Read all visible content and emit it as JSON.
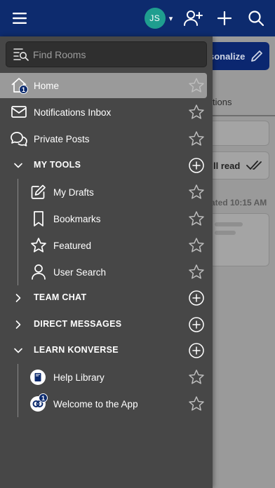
{
  "topbar": {
    "avatar_initials": "JS",
    "caret": "▾",
    "icons": [
      "hamburger-menu-icon",
      "add-user-icon",
      "plus-icon",
      "search-icon"
    ],
    "colors": {
      "bar": "#0d2b6e",
      "avatar": "#1f9e8f"
    }
  },
  "background": {
    "personalize_label": "sonalize",
    "tab_label": "tions",
    "mark_read_label": "ll read",
    "updated_text": "ated 10:15 AM"
  },
  "drawer": {
    "search_placeholder": "Find Rooms",
    "items": [
      {
        "label": "Home",
        "icon": "home-icon",
        "badge": "1",
        "active": true
      },
      {
        "label": "Notifications Inbox",
        "icon": "envelope-icon"
      },
      {
        "label": "Private Posts",
        "icon": "chat-bubbles-icon"
      }
    ],
    "sections": [
      {
        "label": "MY TOOLS",
        "expanded": true,
        "items": [
          {
            "label": "My Drafts",
            "icon": "edit-icon"
          },
          {
            "label": "Bookmarks",
            "icon": "bookmark-icon"
          },
          {
            "label": "Featured",
            "icon": "star-outline-icon"
          },
          {
            "label": "User Search",
            "icon": "user-icon"
          }
        ]
      },
      {
        "label": "TEAM CHAT",
        "expanded": false,
        "items": []
      },
      {
        "label": "DIRECT MESSAGES",
        "expanded": false,
        "items": []
      },
      {
        "label": "LEARN KONVERSE",
        "expanded": true,
        "items": [
          {
            "label": "Help Library",
            "icon": "book-icon"
          },
          {
            "label": "Welcome to the App",
            "icon": "app-logo-icon",
            "badge": "1"
          }
        ]
      }
    ],
    "colors": {
      "drawer": "#474747",
      "active": "#9a9a9a"
    }
  }
}
